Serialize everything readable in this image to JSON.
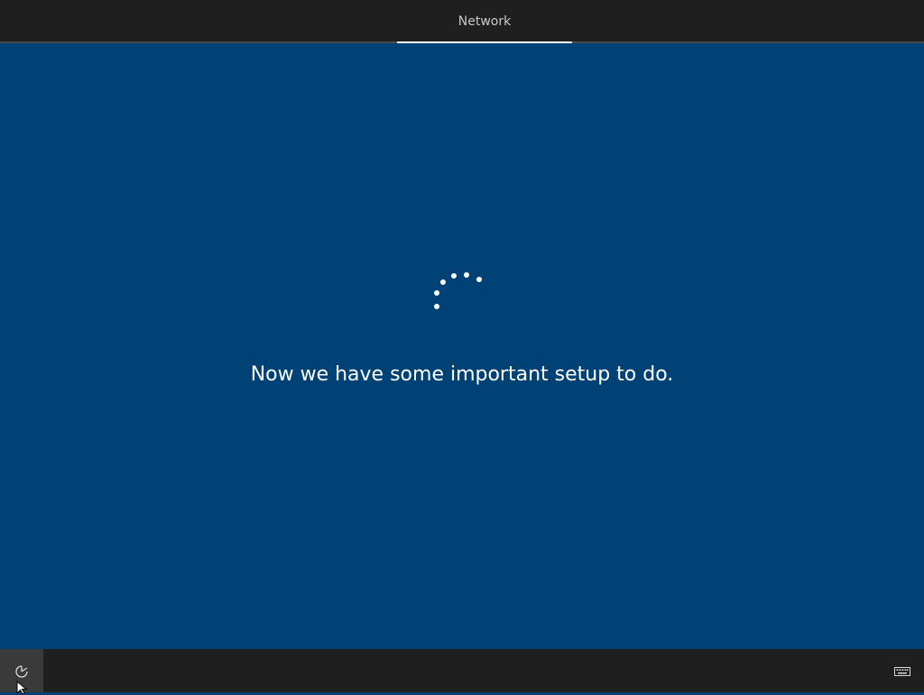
{
  "header": {
    "tabs": [
      {
        "label": "Network",
        "active": true
      }
    ]
  },
  "main": {
    "message": "Now we have some important setup to do.",
    "spinner": {
      "type": "loading-dots",
      "color": "#ffffff"
    }
  },
  "footer": {
    "ease_of_access_icon": "ease-of-access-icon",
    "keyboard_icon": "keyboard-icon"
  },
  "colors": {
    "background": "#004275",
    "bar": "#1f1f1f",
    "text": "#ffffff"
  }
}
